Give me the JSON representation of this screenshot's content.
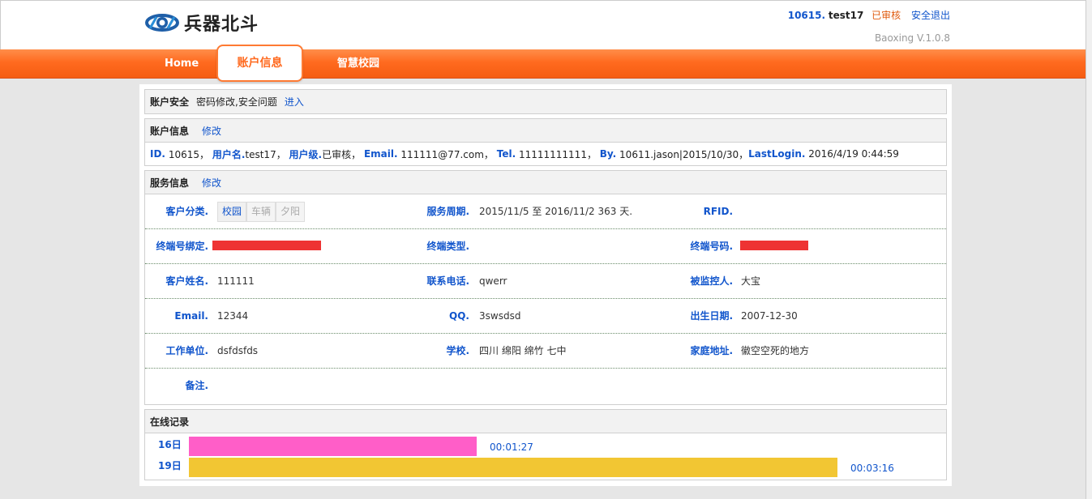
{
  "header": {
    "logo_text": "兵器北斗",
    "user_id": "10615.",
    "user_name": "test17",
    "user_status": "已审核",
    "logout": "安全退出",
    "version": "Baoxing V.1.0.8"
  },
  "nav": {
    "home": "Home",
    "account": "账户信息",
    "campus": "智慧校园"
  },
  "security": {
    "title": "账户安全",
    "desc": "密码修改,安全问题",
    "link": "进入"
  },
  "account": {
    "title": "账户信息",
    "edit": "修改",
    "id_label": "ID.",
    "id_value": "10615，",
    "username_label": "用户名.",
    "username_value": "test17，",
    "level_label": "用户级.",
    "level_value": "已审核，",
    "email_label": "Email.",
    "email_value": "111111@77.com，",
    "tel_label": "Tel.",
    "tel_value": "11111111111，",
    "by_label": "By.",
    "by_value": "10611.jason|2015/10/30，",
    "lastlogin_label": "LastLogin.",
    "lastlogin_value": "2016/4/19 0:44:59"
  },
  "service": {
    "title": "服务信息",
    "edit": "修改",
    "category_label": "客户分类.",
    "category_options": [
      "校园",
      "车辆",
      "夕阳"
    ],
    "period_label": "服务周期.",
    "period_value": "2015/11/5 至 2016/11/2  363 天.",
    "rfid_label": "RFID.",
    "terminal_bind_label": "终端号绑定.",
    "terminal_type_label": "终端类型.",
    "terminal_no_label": "终端号码.",
    "name_label": "客户姓名.",
    "name_value": "111111",
    "phone_label": "联系电话.",
    "phone_value": "qwerr",
    "monitored_label": "被监控人.",
    "monitored_value": "大宝",
    "email_label": "Email.",
    "email_value": "12344",
    "qq_label": "QQ.",
    "qq_value": "3swsdsd",
    "birth_label": "出生日期.",
    "birth_value": "2007-12-30",
    "work_label": "工作单位.",
    "work_value": "dsfdsfds",
    "school_label": "学校.",
    "school_value": "四川 绵阳 绵竹 七中",
    "home_label": "家庭地址.",
    "home_value": "徽空空死的地方",
    "note_label": "备注."
  },
  "online": {
    "title": "在线记录",
    "records": [
      {
        "day": "16日",
        "duration": "00:01:27",
        "color": "#ff5ec8"
      },
      {
        "day": "19日",
        "duration": "00:03:16",
        "color": "#f2c633"
      }
    ]
  }
}
